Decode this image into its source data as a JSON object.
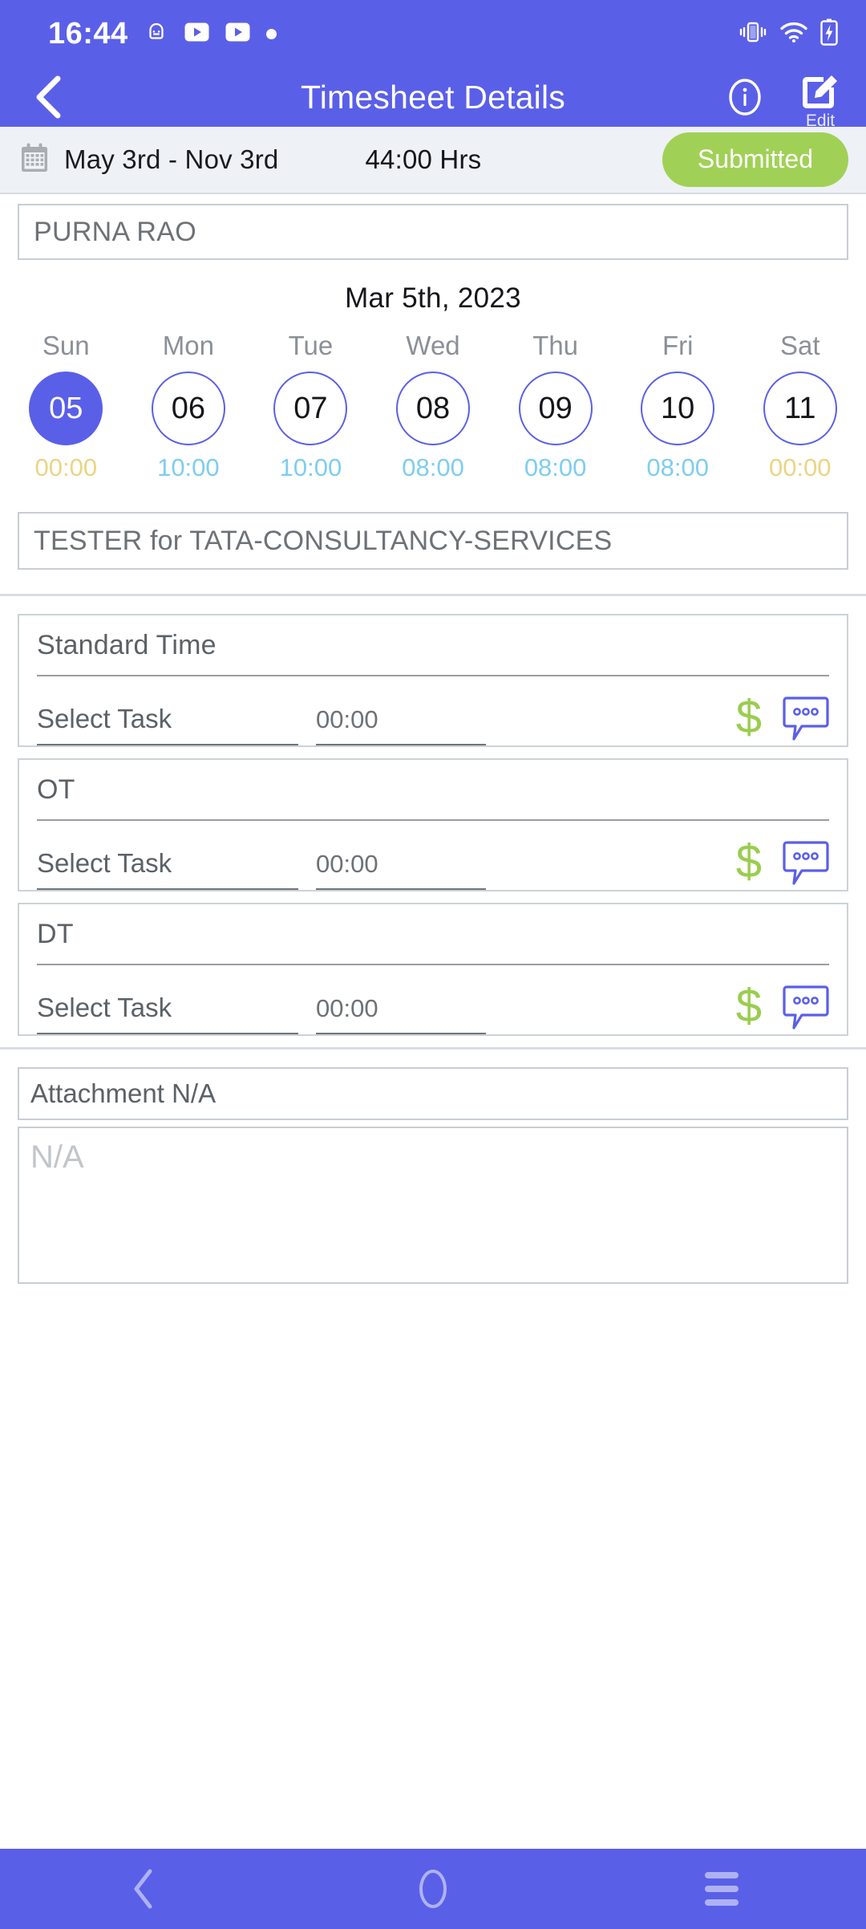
{
  "theme": {
    "primary": "#5a5fe8",
    "accent_green": "#a0d156",
    "dollar_green": "#9acd4f",
    "summary_bg": "#eef1f5",
    "hours_blue": "#7fcdf0",
    "hours_yellow": "#ebd485"
  },
  "status_bar": {
    "clock": "16:44",
    "left_icons": [
      "android-debug-icon",
      "youtube-icon",
      "youtube-icon",
      "dot-icon"
    ],
    "right_icons": [
      "vibrate-icon",
      "wifi-icon",
      "battery-charging-icon"
    ]
  },
  "app_bar": {
    "back_icon": "chevron-left-icon",
    "title": "Timesheet Details",
    "info_icon": "info-circle-icon",
    "edit_icon": "edit-pencil-square-icon",
    "edit_label": "Edit"
  },
  "summary": {
    "calendar_icon": "calendar-icon",
    "period": "May 3rd - Nov 3rd",
    "total_hours": "44:00 Hrs",
    "status": "Submitted"
  },
  "employee": {
    "name": "PURNA RAO"
  },
  "calendar": {
    "selected_date_label": "Mar 5th, 2023",
    "days": [
      {
        "dow": "Sun",
        "day": "05",
        "hours": "00:00",
        "selected": true,
        "zero": true
      },
      {
        "dow": "Mon",
        "day": "06",
        "hours": "10:00",
        "selected": false,
        "zero": false
      },
      {
        "dow": "Tue",
        "day": "07",
        "hours": "10:00",
        "selected": false,
        "zero": false
      },
      {
        "dow": "Wed",
        "day": "08",
        "hours": "08:00",
        "selected": false,
        "zero": false
      },
      {
        "dow": "Thu",
        "day": "09",
        "hours": "08:00",
        "selected": false,
        "zero": false
      },
      {
        "dow": "Fri",
        "day": "10",
        "hours": "08:00",
        "selected": false,
        "zero": false
      },
      {
        "dow": "Sat",
        "day": "11",
        "hours": "00:00",
        "selected": false,
        "zero": true
      }
    ]
  },
  "project": {
    "assignment": "TESTER for TATA-CONSULTANCY-SERVICES"
  },
  "time_cards": [
    {
      "title": "Standard Time",
      "task_placeholder": "Select Task",
      "duration": "00:00",
      "pay_icon": "dollar-icon",
      "comment_icon": "comment-bubble-icon"
    },
    {
      "title": "OT",
      "task_placeholder": "Select Task",
      "duration": "00:00",
      "pay_icon": "dollar-icon",
      "comment_icon": "comment-bubble-icon"
    },
    {
      "title": "DT",
      "task_placeholder": "Select Task",
      "duration": "00:00",
      "pay_icon": "dollar-icon",
      "comment_icon": "comment-bubble-icon"
    }
  ],
  "attachment": {
    "label": "Attachment N/A",
    "body_placeholder": "N/A"
  },
  "nav_bar": {
    "back_icon": "chevron-left-icon",
    "home_icon": "circle-home-icon",
    "recents_icon": "hamburger-recents-icon"
  }
}
